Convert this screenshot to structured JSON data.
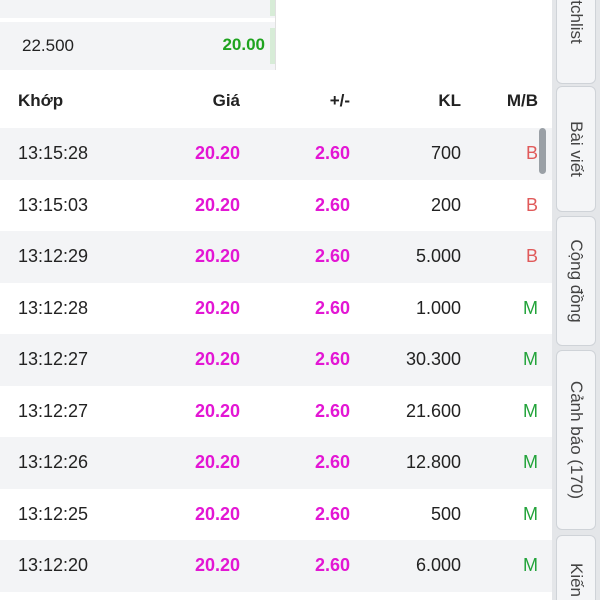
{
  "orderbook": [
    {
      "volume": "",
      "price": ""
    },
    {
      "volume": "22.500",
      "price": "20.00"
    }
  ],
  "table": {
    "headers": {
      "time": "Khớp",
      "price": "Giá",
      "change": "+/-",
      "volume": "KL",
      "side": "M/B"
    },
    "rows": [
      {
        "time": "13:15:28",
        "price": "20.20",
        "change": "2.60",
        "volume": "700",
        "side": "B"
      },
      {
        "time": "13:15:03",
        "price": "20.20",
        "change": "2.60",
        "volume": "200",
        "side": "B"
      },
      {
        "time": "13:12:29",
        "price": "20.20",
        "change": "2.60",
        "volume": "5.000",
        "side": "B"
      },
      {
        "time": "13:12:28",
        "price": "20.20",
        "change": "2.60",
        "volume": "1.000",
        "side": "M"
      },
      {
        "time": "13:12:27",
        "price": "20.20",
        "change": "2.60",
        "volume": "30.300",
        "side": "M"
      },
      {
        "time": "13:12:27",
        "price": "20.20",
        "change": "2.60",
        "volume": "21.600",
        "side": "M"
      },
      {
        "time": "13:12:26",
        "price": "20.20",
        "change": "2.60",
        "volume": "12.800",
        "side": "M"
      },
      {
        "time": "13:12:25",
        "price": "20.20",
        "change": "2.60",
        "volume": "500",
        "side": "M"
      },
      {
        "time": "13:12:20",
        "price": "20.20",
        "change": "2.60",
        "volume": "6.000",
        "side": "M"
      }
    ]
  },
  "sidebar_tabs": [
    "tchlist",
    "Bài viết",
    "Cộng đồng",
    "Cảnh báo (170)",
    "Kiến"
  ],
  "colors": {
    "price": "#e316d4",
    "buy_up": "#1fa31f",
    "side_b": "#e05a5a",
    "side_m": "#22a33a"
  }
}
